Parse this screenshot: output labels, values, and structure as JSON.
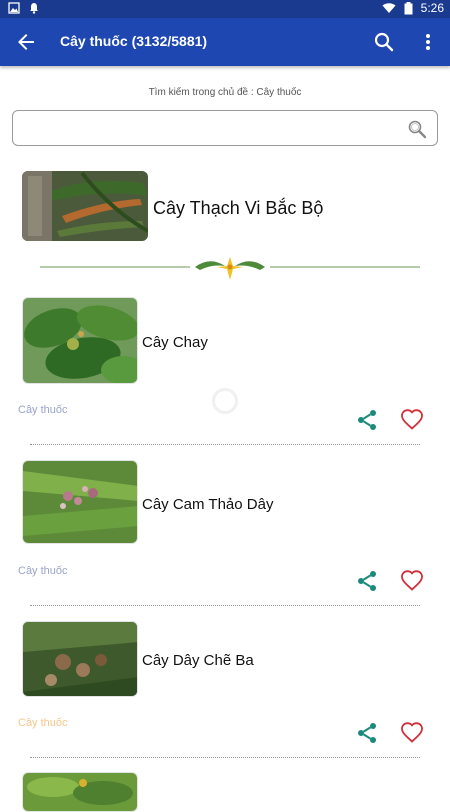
{
  "status_bar": {
    "time": "5:26",
    "icons": [
      "image-icon",
      "notification-icon",
      "wifi-icon",
      "battery-icon"
    ]
  },
  "app_bar": {
    "title": "Cây thuốc (3132/5881)"
  },
  "search": {
    "hint": "Tìm kiếm trong chủ đề : Cây thuốc",
    "value": "",
    "placeholder": ""
  },
  "featured": {
    "name": "Cây Thạch Vi Bắc Bộ"
  },
  "items": [
    {
      "name": "Cây Chay",
      "category": "Cây thuốc"
    },
    {
      "name": "Cây Cam Thảo Dây",
      "category": "Cây thuốc"
    },
    {
      "name": "Cây Dây Chẽ Ba",
      "category": "Cây thuốc"
    }
  ],
  "colors": {
    "appbar": "#1f47b1",
    "statusbar": "#1a3a8f",
    "share": "#1b8a7a",
    "heart": "#d0303a",
    "category": "#9aa4c8",
    "category_alt": "#f2c88a"
  }
}
